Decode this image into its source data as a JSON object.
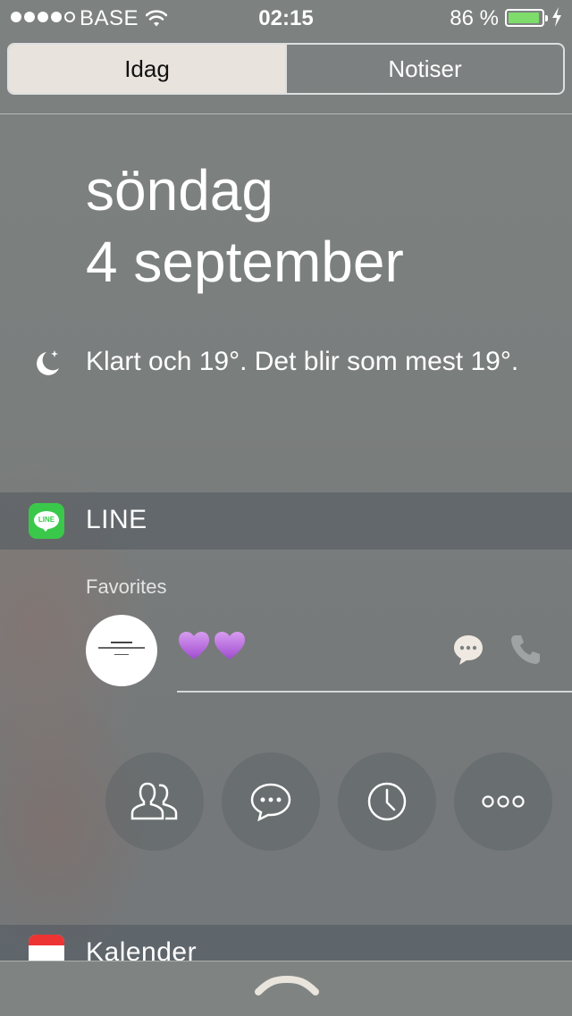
{
  "status_bar": {
    "carrier": "BASE",
    "time": "02:15",
    "battery_percent": "86 %",
    "signal_strength": 4,
    "battery_level": 0.86,
    "battery_color": "#7ddc6a"
  },
  "tabs": [
    {
      "label": "Idag",
      "selected": true
    },
    {
      "label": "Notiser",
      "selected": false
    }
  ],
  "today": {
    "weekday": "söndag",
    "date": "4 september",
    "weather_icon": "moon-stars-icon",
    "weather_text": "Klart och 19°. Det blir som mest 19°."
  },
  "line_widget": {
    "app_name": "LINE",
    "icon_text": "LINE",
    "icon_color": "#3ac84a",
    "favorites_label": "Favorites",
    "contact_name": "💜💜",
    "actions": [
      "friends-icon",
      "chats-icon",
      "history-icon",
      "more-icon"
    ]
  },
  "calendar_widget": {
    "app_name": "Kalender"
  }
}
